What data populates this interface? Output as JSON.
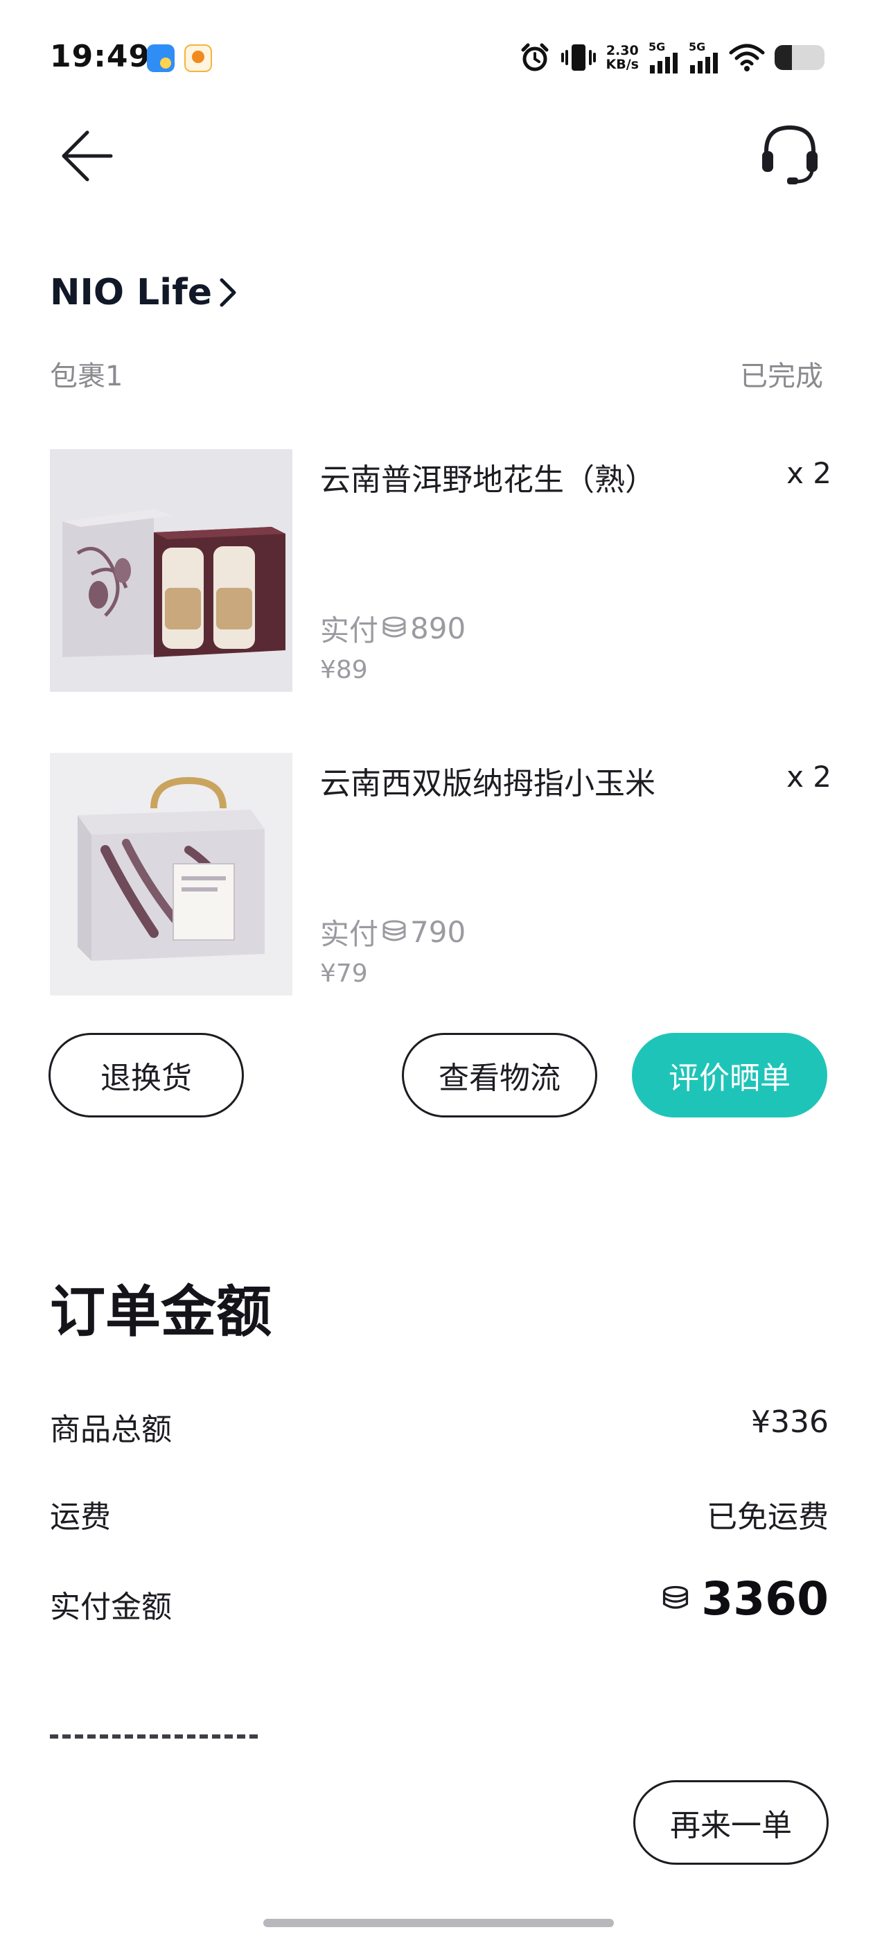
{
  "status_bar": {
    "time": "19:49",
    "net_speed_value": "2.30",
    "net_speed_unit": "KB/s",
    "signal_1_label": "5G",
    "signal_2_label": "5G",
    "battery_level": 0.35
  },
  "header": {
    "back_icon": "arrow-left-icon",
    "support_icon": "headset-icon"
  },
  "store": {
    "name": "NIO Life"
  },
  "package": {
    "label": "包裹1",
    "status": "已完成"
  },
  "products": [
    {
      "name": "云南普洱野地花生（熟）",
      "quantity": "x 2",
      "paid_label": "实付",
      "paid_points": "890",
      "price": "¥89"
    },
    {
      "name": "云南西双版纳拇指小玉米",
      "quantity": "x 2",
      "paid_label": "实付",
      "paid_points": "790",
      "price": "¥79"
    }
  ],
  "actions": {
    "return_label": "退换货",
    "logistics_label": "查看物流",
    "review_label": "评价晒单",
    "reorder_label": "再来一单"
  },
  "order_amount": {
    "title": "订单金额",
    "subtotal_label": "商品总额",
    "subtotal_value": "¥336",
    "shipping_label": "运费",
    "shipping_value": "已免运费",
    "paid_label": "实付金额",
    "paid_value": "3360"
  },
  "colors": {
    "accent": "#1fc4b8",
    "muted_text": "#8a8a8f",
    "primary_text": "#1c1c22"
  }
}
